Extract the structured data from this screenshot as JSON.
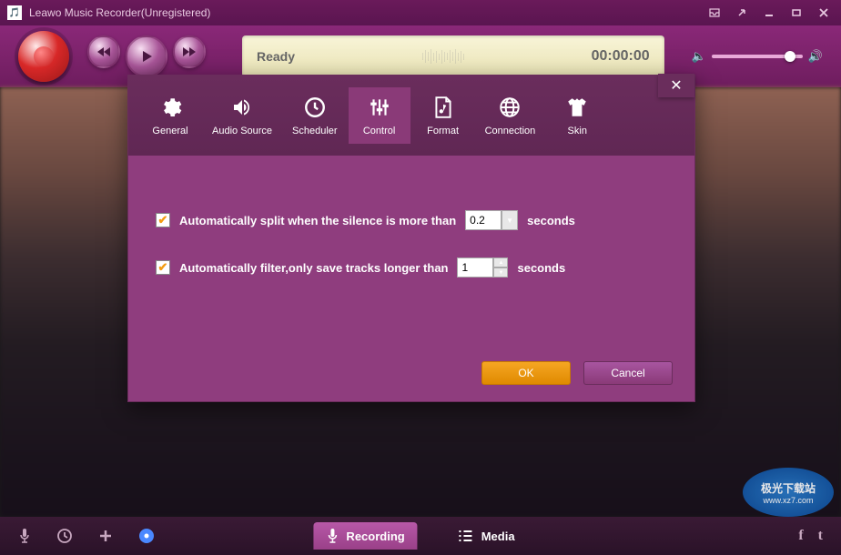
{
  "title": "Leawo Music Recorder(Unregistered)",
  "toolbar": {
    "status": "Ready",
    "timer": "00:00:00"
  },
  "dialog": {
    "tabs": {
      "general": "General",
      "audio_source": "Audio Source",
      "scheduler": "Scheduler",
      "control": "Control",
      "format": "Format",
      "connection": "Connection",
      "skin": "Skin"
    },
    "options": {
      "split_label": "Automatically split when the silence is more than",
      "split_value": "0.2",
      "split_unit": "seconds",
      "filter_label": "Automatically filter,only save tracks longer than",
      "filter_value": "1",
      "filter_unit": "seconds"
    },
    "buttons": {
      "ok": "OK",
      "cancel": "Cancel"
    }
  },
  "bottom_tabs": {
    "recording": "Recording",
    "media": "Media"
  },
  "watermark": {
    "line1": "极光下载站",
    "line2": "www.xz7.com"
  }
}
